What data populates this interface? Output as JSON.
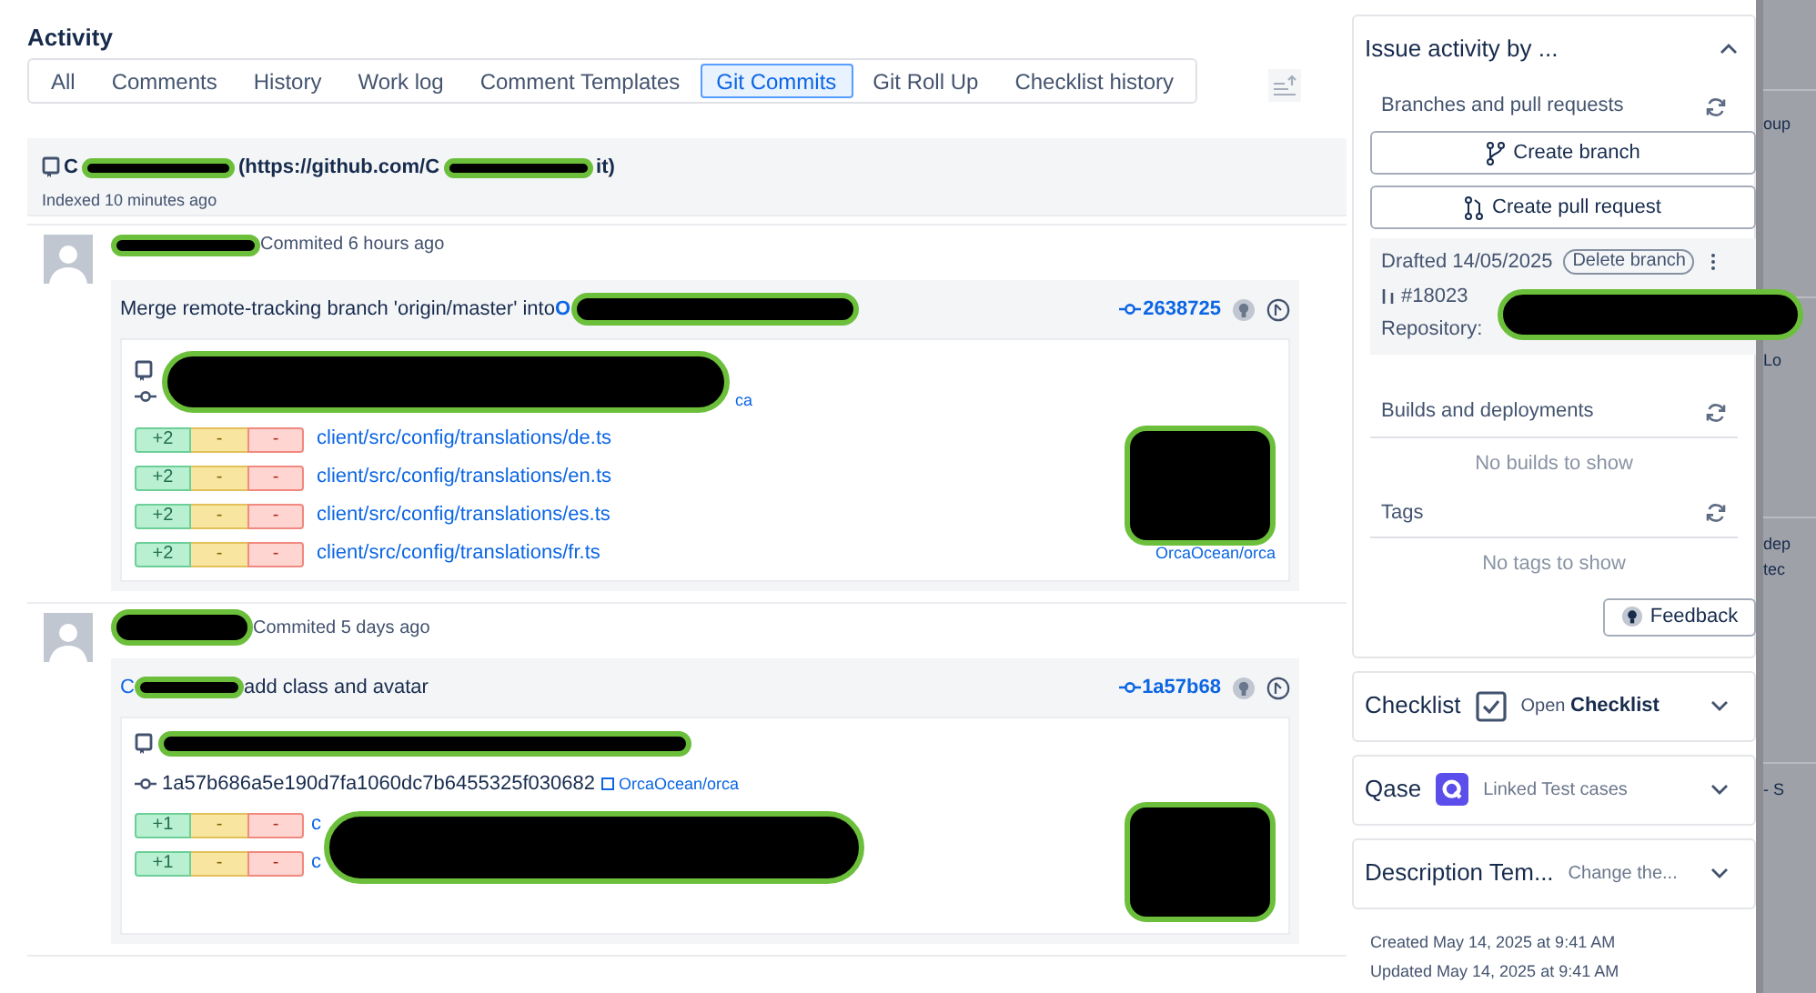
{
  "activity": {
    "title": "Activity",
    "tabs": [
      {
        "label": "All",
        "selected": false
      },
      {
        "label": "Comments",
        "selected": false
      },
      {
        "label": "History",
        "selected": false
      },
      {
        "label": "Work log",
        "selected": false
      },
      {
        "label": "Comment Templates",
        "selected": false
      },
      {
        "label": "Git Commits",
        "selected": true
      },
      {
        "label": "Git Roll Up",
        "selected": false
      },
      {
        "label": "Checklist history",
        "selected": false
      }
    ],
    "repository": {
      "prefix": "C",
      "url_start": "(https://github.com/C",
      "url_end": "it)",
      "indexed": "Indexed 10 minutes ago"
    },
    "commits": [
      {
        "committed": "Commited 6 hours ago",
        "message": "Merge remote-tracking branch 'origin/master' into ",
        "message_tail": "O",
        "hash": "2638725",
        "hash_line_tail": "ca",
        "repo_link": "OrcaOcean/orca",
        "files": [
          {
            "added": "+2",
            "changed": "-",
            "removed": "-",
            "path": "client/src/config/translations/de.ts"
          },
          {
            "added": "+2",
            "changed": "-",
            "removed": "-",
            "path": "client/src/config/translations/en.ts"
          },
          {
            "added": "+2",
            "changed": "-",
            "removed": "-",
            "path": "client/src/config/translations/es.ts"
          },
          {
            "added": "+2",
            "changed": "-",
            "removed": "-",
            "path": "client/src/config/translations/fr.ts"
          }
        ]
      },
      {
        "committed": "Commited 5 days ago",
        "message_head": "C",
        "message": "add class and avatar",
        "hash": "1a57b68",
        "full_hash": "1a57b686a5e190d7fa1060dc7b6455325f030682",
        "inline_repo_link": "OrcaOcean/orca",
        "files": [
          {
            "added": "+1",
            "changed": "-",
            "removed": "-",
            "path": "c"
          },
          {
            "added": "+1",
            "changed": "-",
            "removed": "-",
            "path": "c"
          }
        ]
      }
    ]
  },
  "side_panel": {
    "title": "Issue activity by ...",
    "expanded": true,
    "branches": {
      "title": "Branches and pull requests",
      "buttons": [
        "Create branch",
        "Create pull request"
      ],
      "draft": {
        "drafted": "Drafted 14/05/2025",
        "delete": "Delete branch",
        "pr": "#18023",
        "repository": "Repository:"
      }
    },
    "builds": {
      "title": "Builds and deployments",
      "empty": "No builds to show"
    },
    "tags": {
      "title": "Tags",
      "empty": "No tags to show"
    },
    "feedback": "Feedback"
  },
  "cards": [
    {
      "kind": "checklist",
      "title": "Checklist",
      "open": "Open",
      "label": "Checklist",
      "checked": true
    },
    {
      "kind": "qase",
      "title": "Qase",
      "label": "Linked Test cases"
    },
    {
      "kind": "template",
      "title": "Description Tem...",
      "label": "Change the..."
    }
  ],
  "dates": [
    "Created May 14, 2025 at 9:41 AM",
    "Updated May 14, 2025 at 9:41 AM"
  ],
  "background_fragments": [
    "oup",
    "Lo",
    "dep",
    "tec",
    "- S"
  ]
}
